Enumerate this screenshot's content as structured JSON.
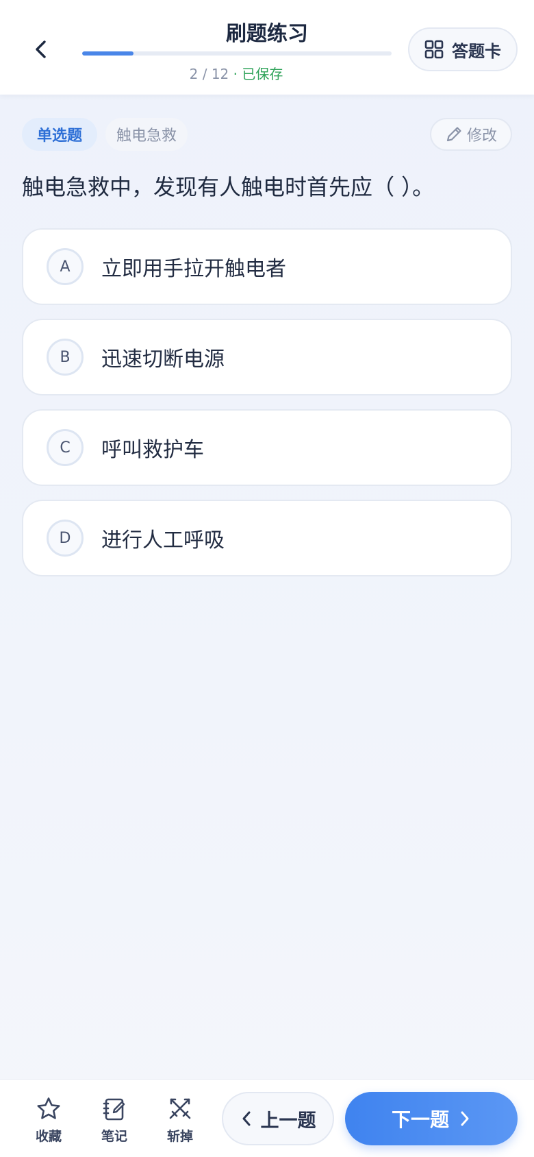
{
  "header": {
    "title": "刷题练习",
    "progress_text": "2 / 12",
    "progress_separator": " · ",
    "saved_text": "已保存",
    "progress_fraction": 0.1667,
    "card_label": "答题卡"
  },
  "question": {
    "type_tag": "单选题",
    "category_tag": "触电急救",
    "edit_label": "修改",
    "text": "触电急救中，发现有人触电时首先应（ ）。",
    "options": [
      {
        "letter": "A",
        "text": "立即用手拉开触电者"
      },
      {
        "letter": "B",
        "text": "迅速切断电源"
      },
      {
        "letter": "C",
        "text": "呼叫救护车"
      },
      {
        "letter": "D",
        "text": "进行人工呼吸"
      }
    ]
  },
  "bottom": {
    "favorite_label": "收藏",
    "note_label": "笔记",
    "remove_label": "斩掉",
    "prev_label": "上一题",
    "next_label": "下一题"
  },
  "icons": {
    "back": "chevron-left-icon",
    "card": "grid-icon",
    "edit": "pencil-icon",
    "favorite": "star-icon",
    "note": "notebook-icon",
    "remove": "crossed-swords-icon",
    "prev": "chevron-left-icon",
    "next": "chevron-right-icon"
  },
  "colors": {
    "accent": "#4a86e8",
    "saved": "#2fa35a",
    "type_tag": "#2d6fd6"
  }
}
